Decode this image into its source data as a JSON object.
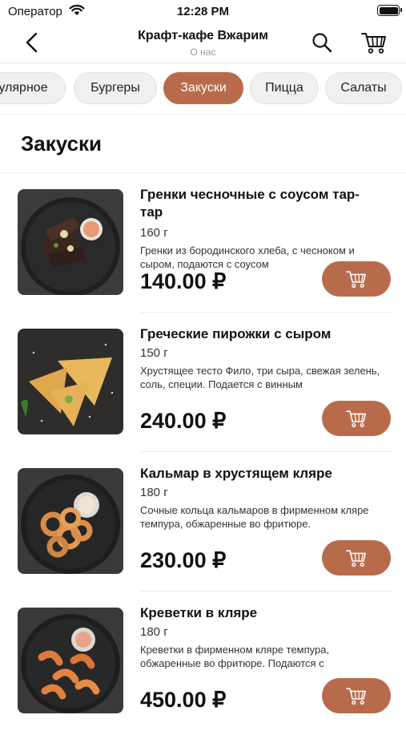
{
  "status": {
    "carrier": "Оператор",
    "time": "12:28 PM"
  },
  "nav": {
    "title": "Крафт-кафе Вжарим",
    "subtitle": "О нас"
  },
  "categories": [
    {
      "label": "улярное"
    },
    {
      "label": "Бургеры"
    },
    {
      "label": "Закуски",
      "active": true
    },
    {
      "label": "Пицца"
    },
    {
      "label": "Салаты"
    }
  ],
  "section": {
    "title": "Закуски"
  },
  "items": [
    {
      "name": "Гренки чесночные с соусом тар-тар",
      "weight": "160 г",
      "desc": "Гренки из бородинского хлеба, с чесноком и сыром, подаются с соусом",
      "price": "140.00 ₽"
    },
    {
      "name": "Греческие пирожки с сыром",
      "weight": "150 г",
      "desc": "Хрустящее тесто Фило, три сыра, свежая зелень, соль, специи. Подается с винным",
      "price": "240.00 ₽"
    },
    {
      "name": "Кальмар в хрустящем кляре",
      "weight": "180 г",
      "desc": "Сочные кольца кальмаров в фирменном кляре темпура, обжаренные во фритюре.",
      "price": "230.00 ₽"
    },
    {
      "name": "Креветки в кляре",
      "weight": "180 г",
      "desc": "Креветки в фирменном кляре темпура, обжаренные во фритюре. Подаются с",
      "price": "450.00 ₽"
    }
  ],
  "colors": {
    "accent": "#b86b4b",
    "chip_bg": "#f0f0f0",
    "divider": "#e8e8e8"
  },
  "icons": {
    "back": "chevron-left-icon",
    "search": "search-icon",
    "cart": "cart-icon",
    "buy": "cart-icon"
  }
}
